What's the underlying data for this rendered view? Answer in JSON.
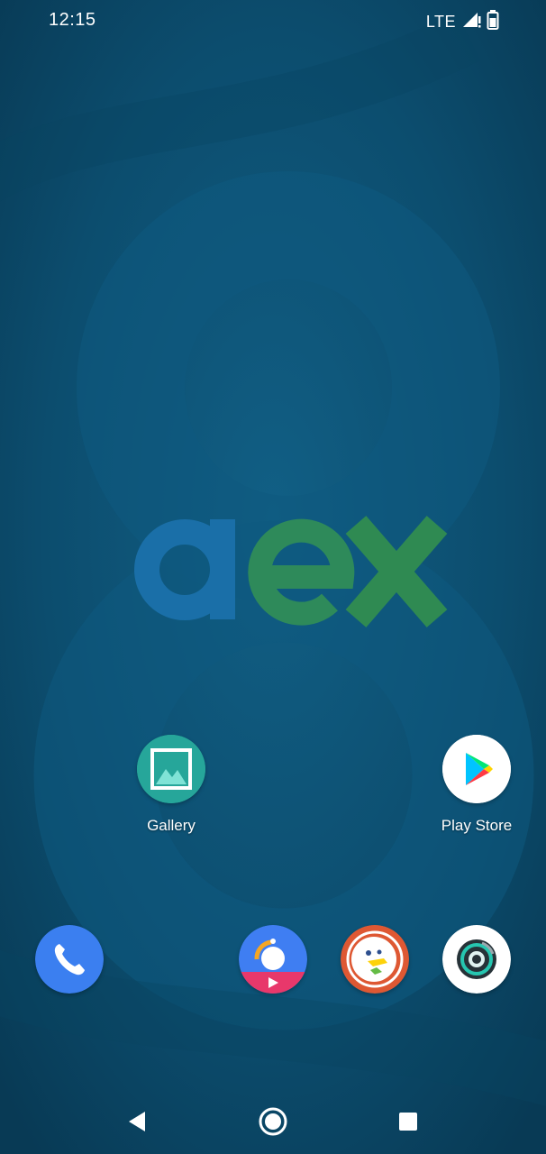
{
  "status_bar": {
    "time": "12:15",
    "network": "LTE",
    "icons": [
      "signal-icon",
      "battery-icon"
    ]
  },
  "wallpaper": {
    "logo_text": "aex",
    "colors": {
      "a": "#1a6fa8",
      "e": "#2e8a5a",
      "x": "#2f8a52"
    }
  },
  "home": {
    "apps": [
      {
        "label": "Gallery",
        "icon": "gallery-icon",
        "color": "#26a69a"
      },
      {
        "label": "Play Store",
        "icon": "play-store-icon",
        "color": "#ffffff"
      }
    ]
  },
  "dock": {
    "apps": [
      {
        "icon": "phone-icon",
        "color": "#3b7ff0"
      },
      {
        "icon": "video-app-icon",
        "color": "#3f7ef2"
      },
      {
        "icon": "duckduckgo-icon",
        "color": "#de5833"
      },
      {
        "icon": "camera-icon",
        "color": "#ffffff"
      }
    ]
  },
  "nav_bar": {
    "buttons": [
      "back",
      "home",
      "recents"
    ]
  }
}
